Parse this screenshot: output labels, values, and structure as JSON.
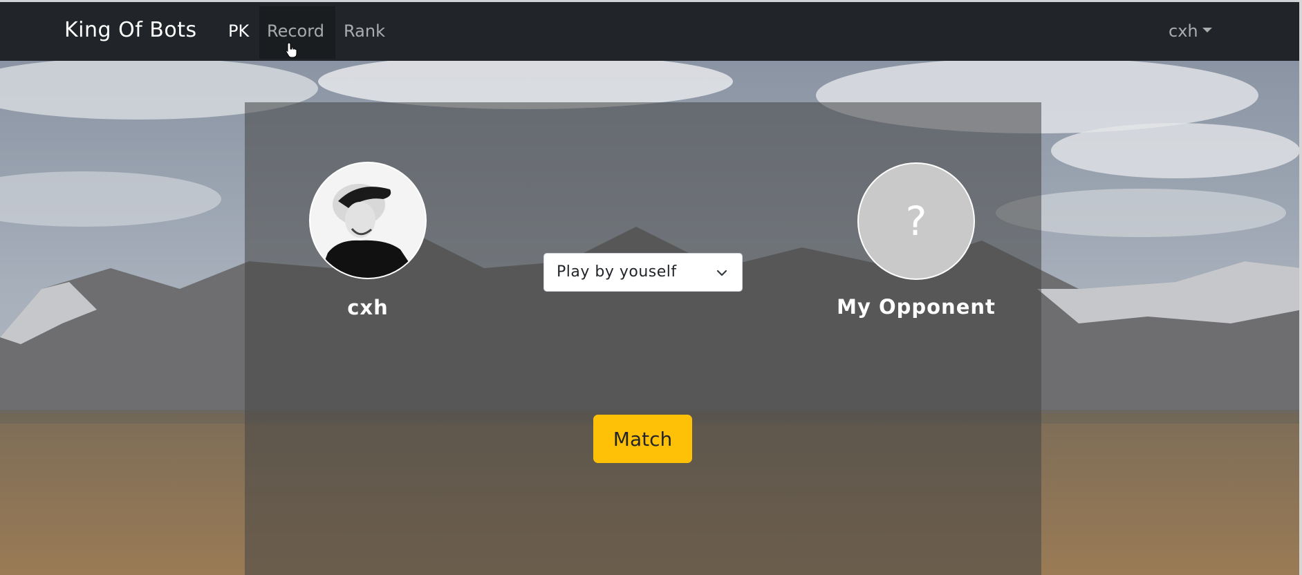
{
  "navbar": {
    "brand": "King Of Bots",
    "links": [
      "PK",
      "Record",
      "Rank"
    ],
    "user": "cxh",
    "caret_icon": "caret-down-icon"
  },
  "match": {
    "self_name": "cxh",
    "opponent_name": "My Opponent",
    "opponent_avatar_placeholder": "?",
    "bot_select": {
      "selected": "Play by youself",
      "icon": "chevron-down-icon"
    },
    "match_button": "Match"
  },
  "colors": {
    "navbar_bg": "#212529",
    "match_button": "#ffc107",
    "card_overlay": "rgba(70,70,70,0.55)"
  }
}
